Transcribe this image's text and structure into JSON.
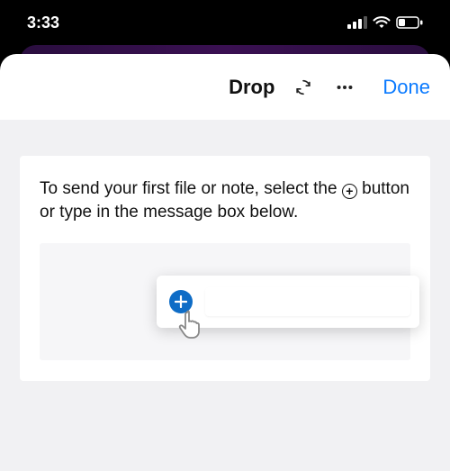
{
  "status_bar": {
    "time": "3:33"
  },
  "header": {
    "title": "Drop",
    "done_label": "Done"
  },
  "card": {
    "text_part1": "To send your first file or note, select the",
    "text_part2": "button or type in the message box below."
  }
}
